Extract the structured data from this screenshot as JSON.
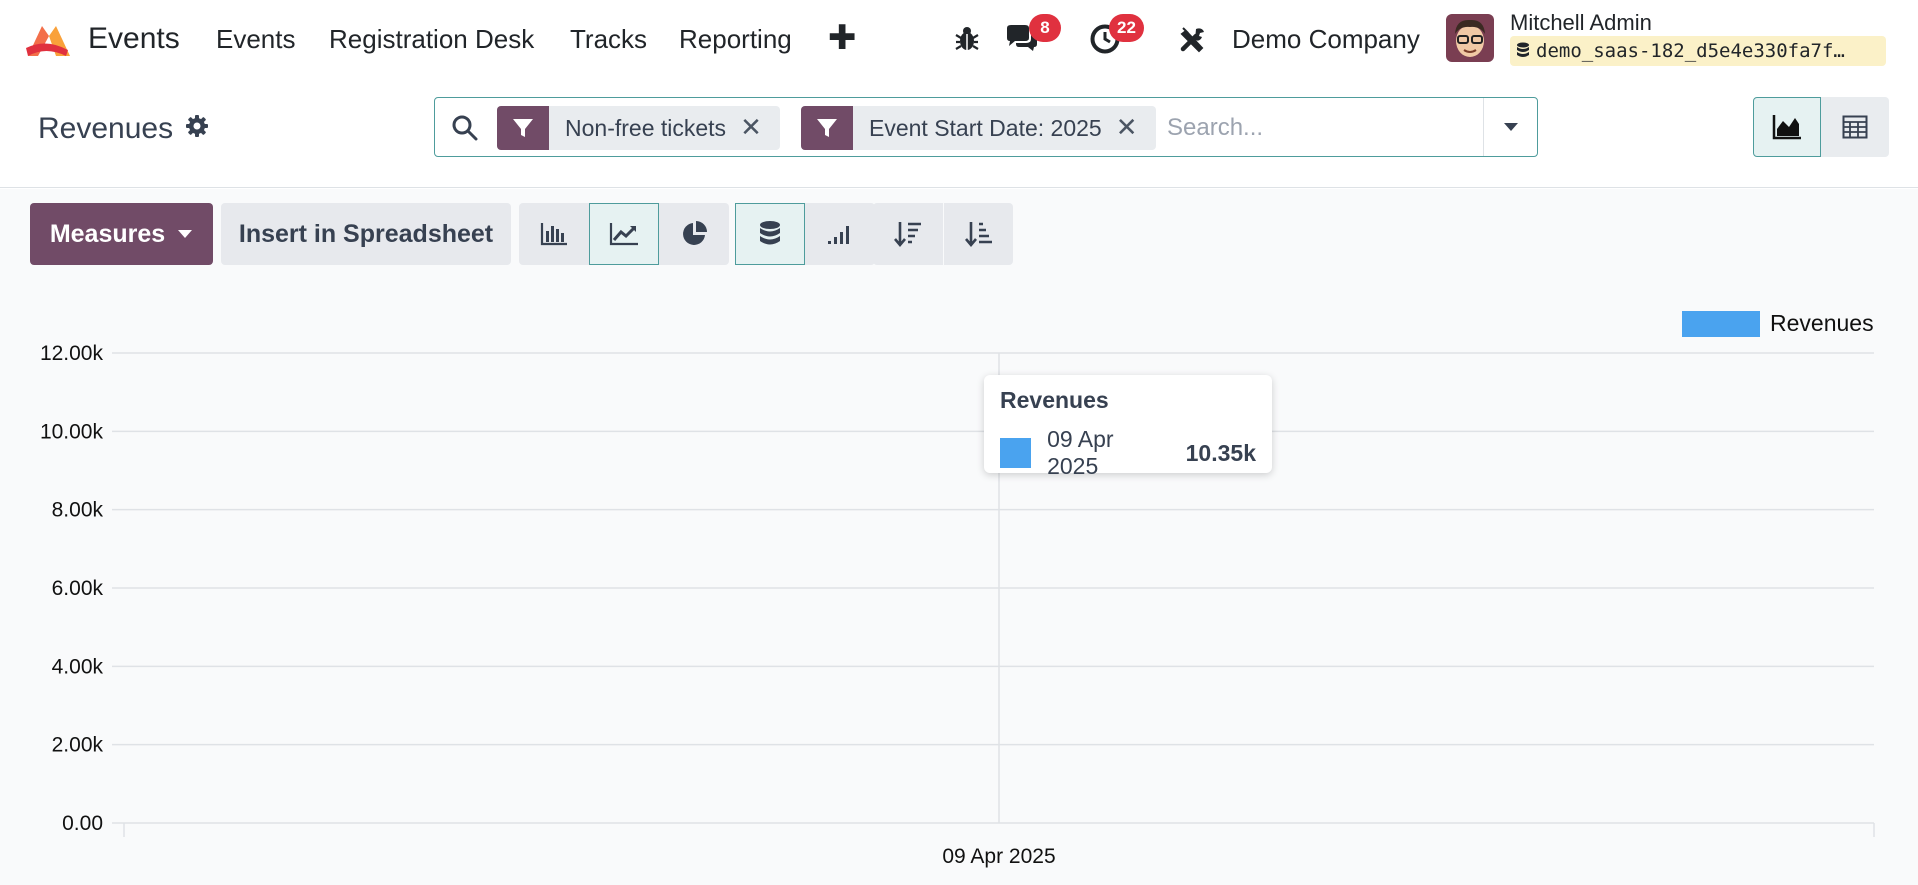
{
  "navbar": {
    "app_name": "Events",
    "menu": [
      "Events",
      "Registration Desk",
      "Tracks",
      "Reporting"
    ],
    "messages_count": "8",
    "activities_count": "22",
    "company": "Demo Company",
    "user_name": "Mitchell Admin",
    "database": "demo_saas-182_d5e4e330fa7f…"
  },
  "control": {
    "breadcrumb": "Revenues",
    "facets": [
      "Non-free tickets",
      "Event Start Date: 2025"
    ],
    "search_placeholder": "Search..."
  },
  "toolbar": {
    "measures_label": "Measures",
    "insert_label": "Insert in Spreadsheet"
  },
  "tooltip": {
    "title": "Revenues",
    "label": "09 Apr 2025",
    "value": "10.35k"
  },
  "colors": {
    "brand": "#714b67",
    "accent": "#4e9c9c",
    "series": "#4aa3ef",
    "badge": "#e0313f"
  },
  "chart_data": {
    "type": "line",
    "categories": [
      "09 Apr 2025"
    ],
    "series": [
      {
        "name": "Revenues",
        "values": [
          10350
        ]
      }
    ],
    "ylim": [
      0,
      12000
    ],
    "yticks": [
      0,
      2000,
      4000,
      6000,
      8000,
      10000,
      12000
    ],
    "ytick_labels": [
      "0.00",
      "2.00k",
      "4.00k",
      "6.00k",
      "8.00k",
      "10.00k",
      "12.00k"
    ],
    "grid": true,
    "legend": "top-right",
    "stacked": true
  }
}
